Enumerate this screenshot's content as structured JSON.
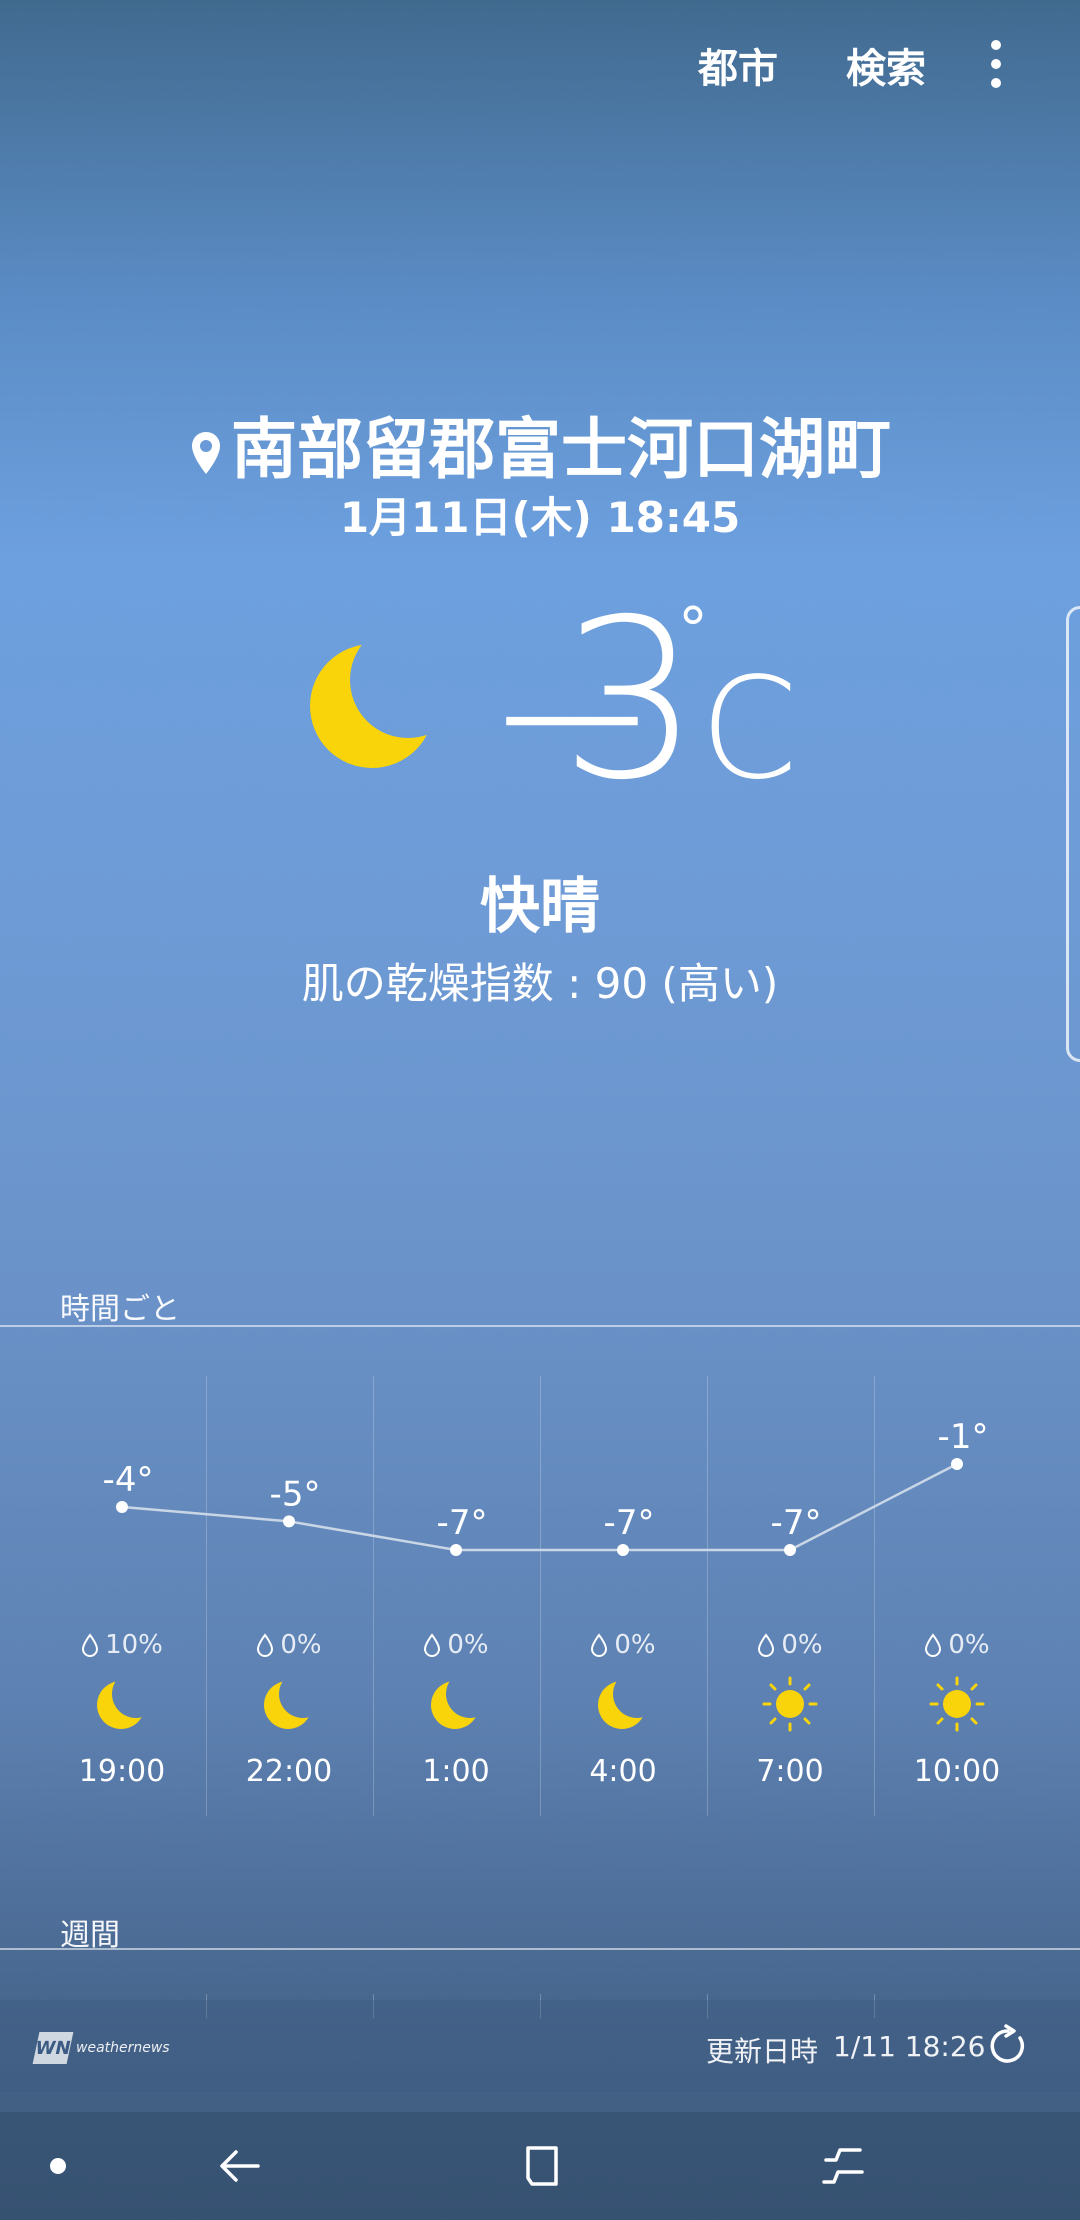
{
  "topbar": {
    "cities_label": "都市",
    "search_label": "検索"
  },
  "current": {
    "location": "南部留郡富士河口湖町",
    "datetime": "1月11日(木) 18:45",
    "temp_sign": "−",
    "temp_value": "3",
    "temp_degree": "°",
    "temp_unit": "C",
    "condition": "快晴",
    "skin_dryness": "肌の乾燥指数 : 90 (高い)"
  },
  "hourly": {
    "label": "時間ごと",
    "items": [
      {
        "time": "19:00",
        "temp": "-4°",
        "temp_value": -4,
        "precip": "10%",
        "icon": "moon-icon"
      },
      {
        "time": "22:00",
        "temp": "-5°",
        "temp_value": -5,
        "precip": "0%",
        "icon": "moon-icon"
      },
      {
        "time": "1:00",
        "temp": "-7°",
        "temp_value": -7,
        "precip": "0%",
        "icon": "moon-icon"
      },
      {
        "time": "4:00",
        "temp": "-7°",
        "temp_value": -7,
        "precip": "0%",
        "icon": "moon-icon"
      },
      {
        "time": "7:00",
        "temp": "-7°",
        "temp_value": -7,
        "precip": "0%",
        "icon": "sun-icon"
      },
      {
        "time": "10:00",
        "temp": "-1°",
        "temp_value": -1,
        "precip": "0%",
        "icon": "sun-icon"
      }
    ]
  },
  "weekly": {
    "label": "週間"
  },
  "footer": {
    "brand": "weathernews",
    "update_label": "更新日時",
    "update_value": "1/11  18:26"
  },
  "colors": {
    "icon_yellow": "#f9d40a",
    "line": "#c9d6e6"
  }
}
